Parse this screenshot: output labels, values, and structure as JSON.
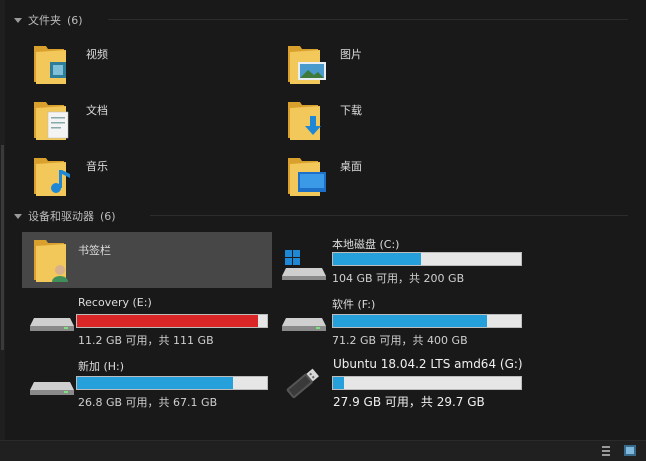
{
  "folders_section": {
    "title": "文件夹",
    "count": "(6)"
  },
  "folders": [
    {
      "label": "视频",
      "icon": "video-folder-icon"
    },
    {
      "label": "图片",
      "icon": "pictures-folder-icon"
    },
    {
      "label": "文档",
      "icon": "documents-folder-icon"
    },
    {
      "label": "下载",
      "icon": "downloads-folder-icon"
    },
    {
      "label": "音乐",
      "icon": "music-folder-icon"
    },
    {
      "label": "桌面",
      "icon": "desktop-folder-icon"
    }
  ],
  "devices_section": {
    "title": "设备和驱动器",
    "count": "(6)"
  },
  "drives": [
    {
      "name": "书签栏",
      "info": "",
      "fill": null,
      "icon": "user-folder-icon",
      "selected": true
    },
    {
      "name": "本地磁盘 (C:)",
      "info": "104 GB 可用，共 200 GB",
      "fill": 0.47,
      "color": "#26a0da",
      "icon": "windows-drive-icon"
    },
    {
      "name": "Recovery (E:)",
      "info": "11.2 GB 可用，共 111 GB",
      "fill": 0.95,
      "color": "#da2626",
      "icon": "usb-drive-icon"
    },
    {
      "name": "软件 (F:)",
      "info": "71.2 GB 可用，共 400 GB",
      "fill": 0.82,
      "color": "#26a0da",
      "icon": "usb-drive-icon"
    },
    {
      "name": "新加 (H:)",
      "info": "26.8 GB 可用，共 67.1 GB",
      "fill": 0.82,
      "color": "#26a0da",
      "icon": "usb-drive-icon"
    },
    {
      "name": "Ubuntu 18.04.2 LTS amd64 (G:)",
      "info": "27.9 GB 可用，共 29.7 GB",
      "fill": 0.06,
      "color": "#26a0da",
      "icon": "usb-stick-icon"
    }
  ],
  "statusbar": {
    "view_details": "details-view-icon",
    "view_tiles": "tiles-view-icon"
  }
}
